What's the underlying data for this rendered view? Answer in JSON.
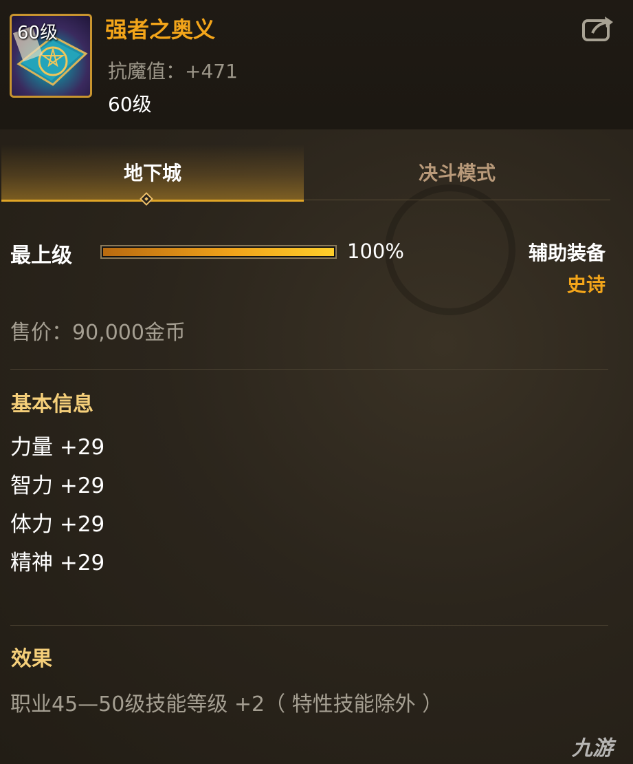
{
  "item": {
    "icon_level": "60级",
    "name": "强者之奥义",
    "stat": "抗魔值：+471",
    "level": "60级"
  },
  "tabs": [
    {
      "label": "地下城",
      "active": true
    },
    {
      "label": "决斗模式",
      "active": false
    }
  ],
  "grade": {
    "label": "最上级",
    "progress": 1.0,
    "percent_text": "100%"
  },
  "equipment": {
    "type": "辅助装备",
    "rarity": "史诗"
  },
  "price": "售价：90,000金币",
  "basic_info": {
    "title": "基本信息",
    "stats": [
      "力量 +29",
      "智力 +29",
      "体力 +29",
      "精神 +29"
    ]
  },
  "effect": {
    "title": "效果",
    "text": "职业45—50级技能等级 +2（ 特性技能除外 ）"
  },
  "watermark": "九游",
  "colors": {
    "accent_gold": "#f3a51a",
    "section_title": "#f5cf7a",
    "muted_text": "#a59f92"
  },
  "icons": {
    "share": "share-export-icon",
    "item": "spellbook-pentagram-icon"
  }
}
